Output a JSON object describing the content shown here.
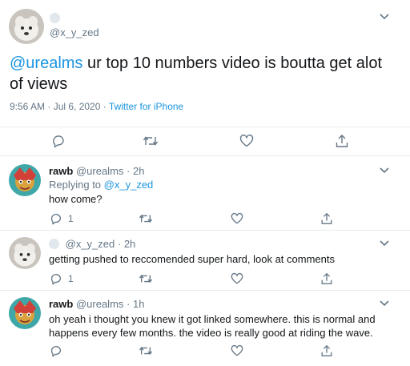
{
  "main_tweet": {
    "handle": "@x_y_zed",
    "text_mention": "@urealms",
    "text_body": " ur top 10 numbers video is boutta get alot of views",
    "timestamp": "9:56 AM · Jul 6, 2020",
    "meta_separator": " · ",
    "source": "Twitter for iPhone",
    "actions": {
      "reply": "reply-icon",
      "retweet": "retweet-icon",
      "like": "heart-icon",
      "share": "share-icon"
    }
  },
  "replies": [
    {
      "name": "rawb",
      "handle": "@urealms",
      "time": "· 2h",
      "replying_prefix": "Replying to ",
      "replying_handle": "@x_y_zed",
      "text": "how come?",
      "reply_count": "1",
      "like_count": ""
    },
    {
      "name": "",
      "handle": "@x_y_zed",
      "time": "· 2h",
      "text": "getting pushed to reccomended super hard, look at comments",
      "reply_count": "1",
      "like_count": ""
    },
    {
      "name": "rawb",
      "handle": "@urealms",
      "time": "· 1h",
      "text": "oh yeah i thought you knew it got linked somewhere. this is normal and happens every few months. the video is really good at riding the wave.",
      "reply_count": "",
      "like_count": ""
    }
  ],
  "colors": {
    "accent": "#1b95e0",
    "muted": "#657786",
    "border": "#e6ecf0"
  }
}
